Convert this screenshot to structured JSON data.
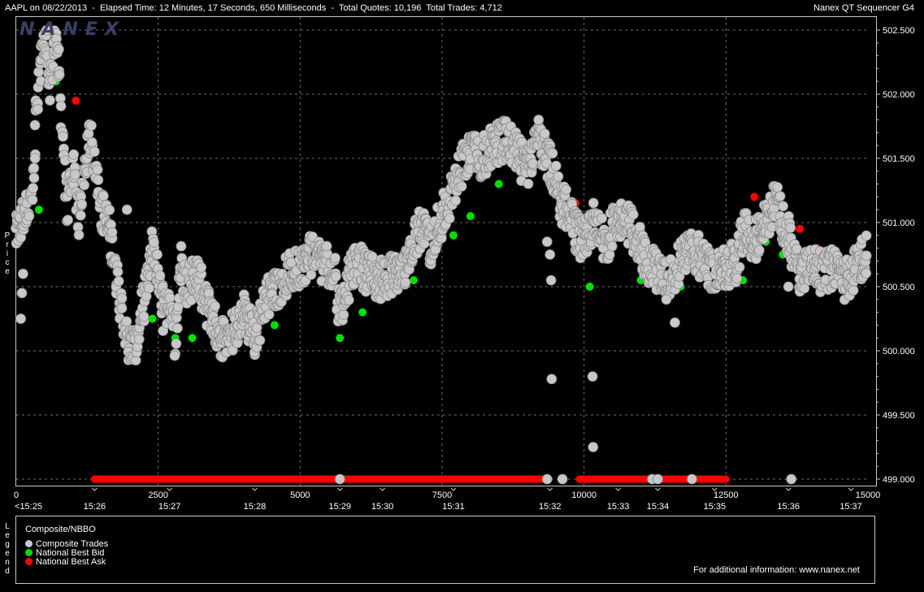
{
  "header": {
    "info_text": "AAPL on 08/22/2013  -  Elapsed Time: 12 Minutes, 17 Seconds, 650 Milliseconds  -  Total Quotes: 10,196  Total Trades: 4,712",
    "product": "Nanex QT Sequencer G4"
  },
  "watermark": "NANEX",
  "price_axis_label": "Price",
  "legend": {
    "side_label": "Legend",
    "title": "Composite/NBBO",
    "items": [
      {
        "label": "Composite Trades",
        "color": "#c8c8c8"
      },
      {
        "label": "National Best Bid",
        "color": "#00e000"
      },
      {
        "label": "National Best Ask",
        "color": "#ff0000"
      }
    ],
    "info": "For additional information: www.nanex.net"
  },
  "colors": {
    "background": "#000000",
    "frame": "#c8c8c8",
    "grid": "#6e6e6e",
    "trade": "#c8c8c8",
    "bid": "#00e000",
    "ask": "#ff0000"
  },
  "chart_data": {
    "type": "scatter",
    "xlim": [
      0,
      15000
    ],
    "ylim": [
      498.95,
      502.65
    ],
    "y_ticks": [
      499.0,
      499.5,
      500.0,
      500.5,
      501.0,
      501.5,
      502.0,
      502.5
    ],
    "y_tick_labels": [
      "499.000",
      "499.500",
      "500.000",
      "500.500",
      "501.000",
      "501.500",
      "502.000",
      "502.500"
    ],
    "x_count_ticks": [
      0,
      2500,
      5000,
      7500,
      10000,
      12500,
      15000
    ],
    "x_count_labels": [
      "0",
      "2500",
      "5000",
      "7500",
      "10000",
      "12500",
      "15000"
    ],
    "x_time_ticks": [
      {
        "label": "<15:25",
        "x": 0
      },
      {
        "label": "15:26",
        "x": 1380
      },
      {
        "label": "15:27",
        "x": 2700
      },
      {
        "label": "15:28",
        "x": 4200
      },
      {
        "label": "15:29",
        "x": 5700
      },
      {
        "label": "15:30",
        "x": 6450
      },
      {
        "label": "15:31",
        "x": 7700
      },
      {
        "label": "15:32",
        "x": 9400
      },
      {
        "label": "15:33",
        "x": 10600
      },
      {
        "label": "15:34",
        "x": 11300
      },
      {
        "label": "15:35",
        "x": 12300
      },
      {
        "label": "15:36",
        "x": 13600
      },
      {
        "label": "15:37",
        "x": 14700
      }
    ],
    "grid": true,
    "legend_position": "bottom",
    "series": [
      {
        "name": "Composite Trades",
        "color": "#c8c8c8",
        "price_path": [
          [
            0,
            500.9
          ],
          [
            100,
            501.0
          ],
          [
            200,
            501.1
          ],
          [
            300,
            501.3
          ],
          [
            350,
            501.8
          ],
          [
            400,
            502.1
          ],
          [
            450,
            502.3
          ],
          [
            500,
            502.45
          ],
          [
            550,
            502.35
          ],
          [
            600,
            502.0
          ],
          [
            700,
            502.5
          ],
          [
            750,
            502.2
          ],
          [
            800,
            501.7
          ],
          [
            900,
            501.1
          ],
          [
            1000,
            501.5
          ],
          [
            1100,
            501.0
          ],
          [
            1200,
            501.3
          ],
          [
            1300,
            501.7
          ],
          [
            1400,
            501.4
          ],
          [
            1500,
            501.1
          ],
          [
            1650,
            500.95
          ],
          [
            1750,
            500.6
          ],
          [
            1850,
            500.35
          ],
          [
            1950,
            500.1
          ],
          [
            2100,
            500.0
          ],
          [
            2200,
            500.3
          ],
          [
            2300,
            500.5
          ],
          [
            2400,
            500.8
          ],
          [
            2500,
            500.6
          ],
          [
            2600,
            500.3
          ],
          [
            2700,
            500.4
          ],
          [
            2800,
            500.1
          ],
          [
            2900,
            500.7
          ],
          [
            3000,
            500.5
          ],
          [
            3200,
            500.6
          ],
          [
            3400,
            500.3
          ],
          [
            3600,
            500.1
          ],
          [
            3800,
            500.15
          ],
          [
            4000,
            500.3
          ],
          [
            4200,
            500.1
          ],
          [
            4400,
            500.4
          ],
          [
            4600,
            500.5
          ],
          [
            4800,
            500.6
          ],
          [
            5000,
            500.65
          ],
          [
            5200,
            500.75
          ],
          [
            5400,
            500.7
          ],
          [
            5600,
            500.6
          ],
          [
            5700,
            500.3
          ],
          [
            5800,
            500.5
          ],
          [
            5900,
            500.6
          ],
          [
            6000,
            500.7
          ],
          [
            6200,
            500.6
          ],
          [
            6400,
            500.55
          ],
          [
            6600,
            500.6
          ],
          [
            6800,
            500.6
          ],
          [
            7000,
            500.85
          ],
          [
            7200,
            501.0
          ],
          [
            7300,
            500.8
          ],
          [
            7400,
            500.95
          ],
          [
            7600,
            501.15
          ],
          [
            7800,
            501.4
          ],
          [
            8000,
            501.55
          ],
          [
            8200,
            501.5
          ],
          [
            8400,
            501.6
          ],
          [
            8600,
            501.65
          ],
          [
            8800,
            501.55
          ],
          [
            9000,
            501.4
          ],
          [
            9200,
            501.65
          ],
          [
            9400,
            501.45
          ],
          [
            9500,
            501.3
          ],
          [
            9600,
            501.15
          ],
          [
            9700,
            501.1
          ],
          [
            9800,
            501.0
          ],
          [
            9900,
            500.9
          ],
          [
            10000,
            500.85
          ],
          [
            10100,
            500.95
          ],
          [
            10200,
            501.05
          ],
          [
            10300,
            500.9
          ],
          [
            10400,
            500.85
          ],
          [
            10500,
            500.95
          ],
          [
            10700,
            501.05
          ],
          [
            10900,
            500.9
          ],
          [
            11100,
            500.7
          ],
          [
            11300,
            500.6
          ],
          [
            11500,
            500.55
          ],
          [
            11700,
            500.7
          ],
          [
            11900,
            500.8
          ],
          [
            12100,
            500.7
          ],
          [
            12300,
            500.6
          ],
          [
            12500,
            500.65
          ],
          [
            12700,
            500.7
          ],
          [
            12800,
            500.95
          ],
          [
            13000,
            500.85
          ],
          [
            13200,
            501.0
          ],
          [
            13300,
            501.1
          ],
          [
            13400,
            501.2
          ],
          [
            13500,
            501.0
          ],
          [
            13600,
            500.9
          ],
          [
            13700,
            500.7
          ],
          [
            13800,
            500.6
          ],
          [
            14000,
            500.7
          ],
          [
            14200,
            500.6
          ],
          [
            14400,
            500.65
          ],
          [
            14600,
            500.55
          ],
          [
            14800,
            500.65
          ],
          [
            15000,
            500.78
          ]
        ],
        "outliers": [
          [
            80,
            500.25
          ],
          [
            1950,
            501.1
          ],
          [
            9350,
            500.85
          ],
          [
            9400,
            500.75
          ],
          [
            9420,
            500.55
          ],
          [
            9430,
            499.78
          ],
          [
            10150,
            499.8
          ],
          [
            10160,
            499.25
          ],
          [
            11450,
            500.4
          ],
          [
            11600,
            500.22
          ],
          [
            13600,
            500.5
          ],
          [
            9200,
            501.8
          ],
          [
            100,
            500.45
          ],
          [
            120,
            500.6
          ]
        ],
        "bottom_outliers": [
          5700,
          9350,
          9620,
          11200,
          11300,
          11900,
          13650
        ]
      },
      {
        "name": "National Best Bid",
        "color": "#00e000",
        "points": [
          [
            400,
            501.1
          ],
          [
            700,
            502.1
          ],
          [
            2400,
            500.25
          ],
          [
            2800,
            500.1
          ],
          [
            3100,
            500.1
          ],
          [
            3500,
            500.15
          ],
          [
            4000,
            500.15
          ],
          [
            4550,
            500.2
          ],
          [
            5700,
            500.1
          ],
          [
            6100,
            500.3
          ],
          [
            6500,
            500.45
          ],
          [
            7000,
            500.55
          ],
          [
            7300,
            500.7
          ],
          [
            7700,
            500.9
          ],
          [
            8000,
            501.05
          ],
          [
            8500,
            501.3
          ],
          [
            9100,
            501.4
          ],
          [
            10100,
            500.5
          ],
          [
            10400,
            500.75
          ],
          [
            11000,
            500.55
          ],
          [
            11700,
            500.5
          ],
          [
            12400,
            500.5
          ],
          [
            12800,
            500.55
          ],
          [
            13200,
            500.85
          ],
          [
            13500,
            500.75
          ],
          [
            14100,
            500.55
          ],
          [
            14650,
            500.55
          ]
        ]
      },
      {
        "name": "National Best Ask",
        "color": "#ff0000",
        "points": [
          [
            500,
            502.35
          ],
          [
            1050,
            501.95
          ],
          [
            9850,
            501.15
          ],
          [
            13000,
            501.2
          ],
          [
            13500,
            501.05
          ],
          [
            13800,
            500.95
          ],
          [
            14100,
            500.8
          ],
          [
            14550,
            500.7
          ],
          [
            14700,
            500.68
          ]
        ],
        "bottom_segments": [
          [
            1380,
            9350
          ],
          [
            9920,
            12500
          ]
        ]
      }
    ]
  }
}
